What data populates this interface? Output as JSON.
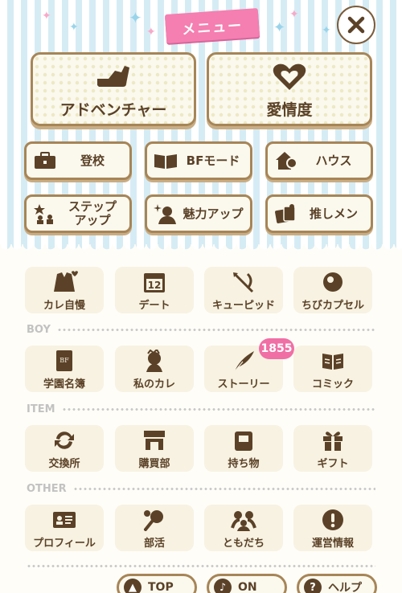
{
  "header": {
    "title": "メニュー"
  },
  "main_buttons": [
    {
      "label": "アドベンチャー",
      "icon": "shoe-icon"
    },
    {
      "label": "愛情度",
      "icon": "heart-icon"
    }
  ],
  "sub_buttons": [
    {
      "label": "登校",
      "icon": "briefcase-icon"
    },
    {
      "label": "BFモード",
      "icon": "book-icon"
    },
    {
      "label": "ハウス",
      "icon": "house-icon"
    },
    {
      "label": "ステップ\nアップ",
      "icon": "step-up-icon"
    },
    {
      "label": "魅力アップ",
      "icon": "sparkle-person-icon"
    },
    {
      "label": "推しメン",
      "icon": "fan-card-icon"
    }
  ],
  "grid": {
    "row1": [
      "カレ自慢",
      "デート",
      "キューピッド",
      "ちびカプセル"
    ],
    "sections": [
      {
        "name": "BOY",
        "items": [
          "学園名簿",
          "私のカレ",
          "ストーリー",
          "コミック"
        ]
      },
      {
        "name": "ITEM",
        "items": [
          "交換所",
          "購買部",
          "持ち物",
          "ギフト"
        ]
      },
      {
        "name": "OTHER",
        "items": [
          "プロフィール",
          "部活",
          "ともだち",
          "運営情報"
        ]
      }
    ],
    "date_number": "12"
  },
  "story_badge": "1855",
  "footer": [
    {
      "label": "TOP",
      "icon": "top-icon"
    },
    {
      "label": "ON",
      "icon": "sound-icon"
    },
    {
      "label": "ヘルプ",
      "icon": "help-icon"
    }
  ],
  "colors": {
    "brown": "#5b4127",
    "pink": "#f47fb0",
    "stripe": "#d6ecf5"
  }
}
